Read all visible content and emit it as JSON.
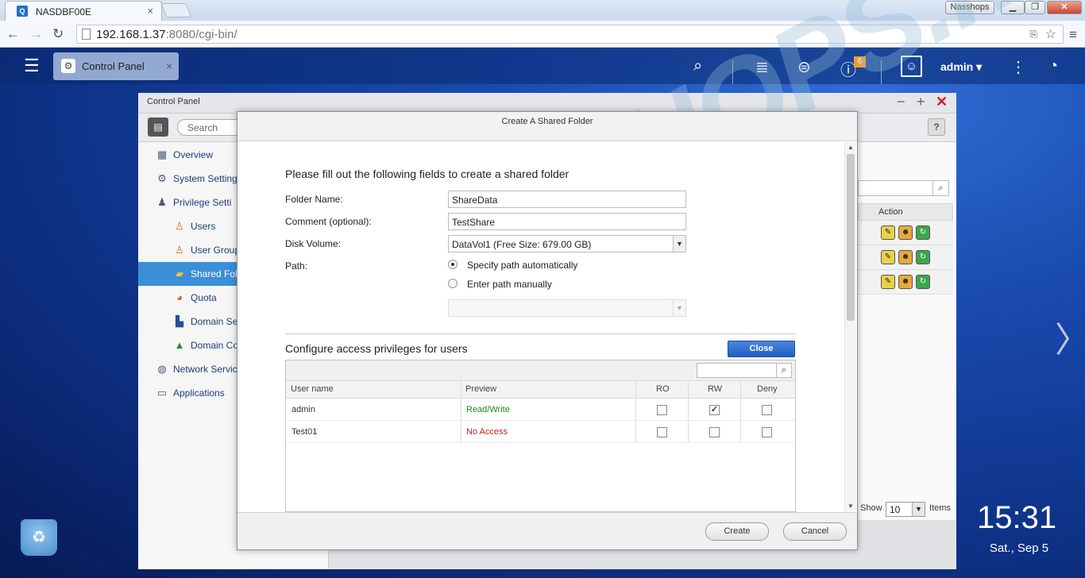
{
  "browser": {
    "tab_title": "NASDBF00E",
    "tab_close": "×",
    "profile": "Nasshops",
    "url_host": "192.168.1.37",
    "url_rest": ":8080/cgi-bin/"
  },
  "topbar": {
    "tab_label": "Control Panel",
    "notification_count": "6",
    "user": "admin ▾"
  },
  "control_panel": {
    "title": "Control Panel",
    "search_placeholder": "Search",
    "help": "?",
    "sidebar": [
      {
        "label": "Overview",
        "icon": "grid-icon"
      },
      {
        "label": "System Setting",
        "icon": "gear-icon"
      },
      {
        "label": "Privilege Setti",
        "icon": "person-icon"
      },
      {
        "label": "Users",
        "icon": "user-icon"
      },
      {
        "label": "User Group",
        "icon": "user-group-icon"
      },
      {
        "label": "Shared Fol",
        "icon": "folder-icon"
      },
      {
        "label": "Quota",
        "icon": "pie-icon"
      },
      {
        "label": "Domain Se",
        "icon": "domain-icon"
      },
      {
        "label": "Domain Co",
        "icon": "domain-controller-icon"
      },
      {
        "label": "Network Servic",
        "icon": "globe-icon"
      },
      {
        "label": "Applications",
        "icon": "apps-icon"
      }
    ],
    "action_header": "Action",
    "show_label": "Show",
    "show_value": "10",
    "items_label": "Items"
  },
  "dialog": {
    "title": "Create A Shared Folder",
    "intro": "Please fill out the following fields to create a shared folder",
    "folder_name_label": "Folder Name:",
    "folder_name_value": "ShareData",
    "comment_label": "Comment (optional):",
    "comment_value": "TestShare",
    "disk_volume_label": "Disk Volume:",
    "disk_volume_value": "DataVol1 (Free Size: 679.00 GB)",
    "path_label": "Path:",
    "path_auto": "Specify path automatically",
    "path_manual": "Enter path manually",
    "access_title": "Configure access privileges for users",
    "close_button": "Close",
    "columns": [
      "User name",
      "Preview",
      "RO",
      "RW",
      "Deny"
    ],
    "rows": [
      {
        "user": "admin",
        "preview": "Read/Write",
        "preview_color": "#1a8a1a",
        "ro": false,
        "rw": true,
        "deny": false
      },
      {
        "user": "Test01",
        "preview": "No Access",
        "preview_color": "#d01818",
        "ro": false,
        "rw": false,
        "deny": false
      }
    ],
    "create_button": "Create",
    "cancel_button": "Cancel"
  },
  "desktop": {
    "time": "15:31",
    "date": "Sat., Sep 5"
  },
  "watermark": "NASSHOPS.net"
}
